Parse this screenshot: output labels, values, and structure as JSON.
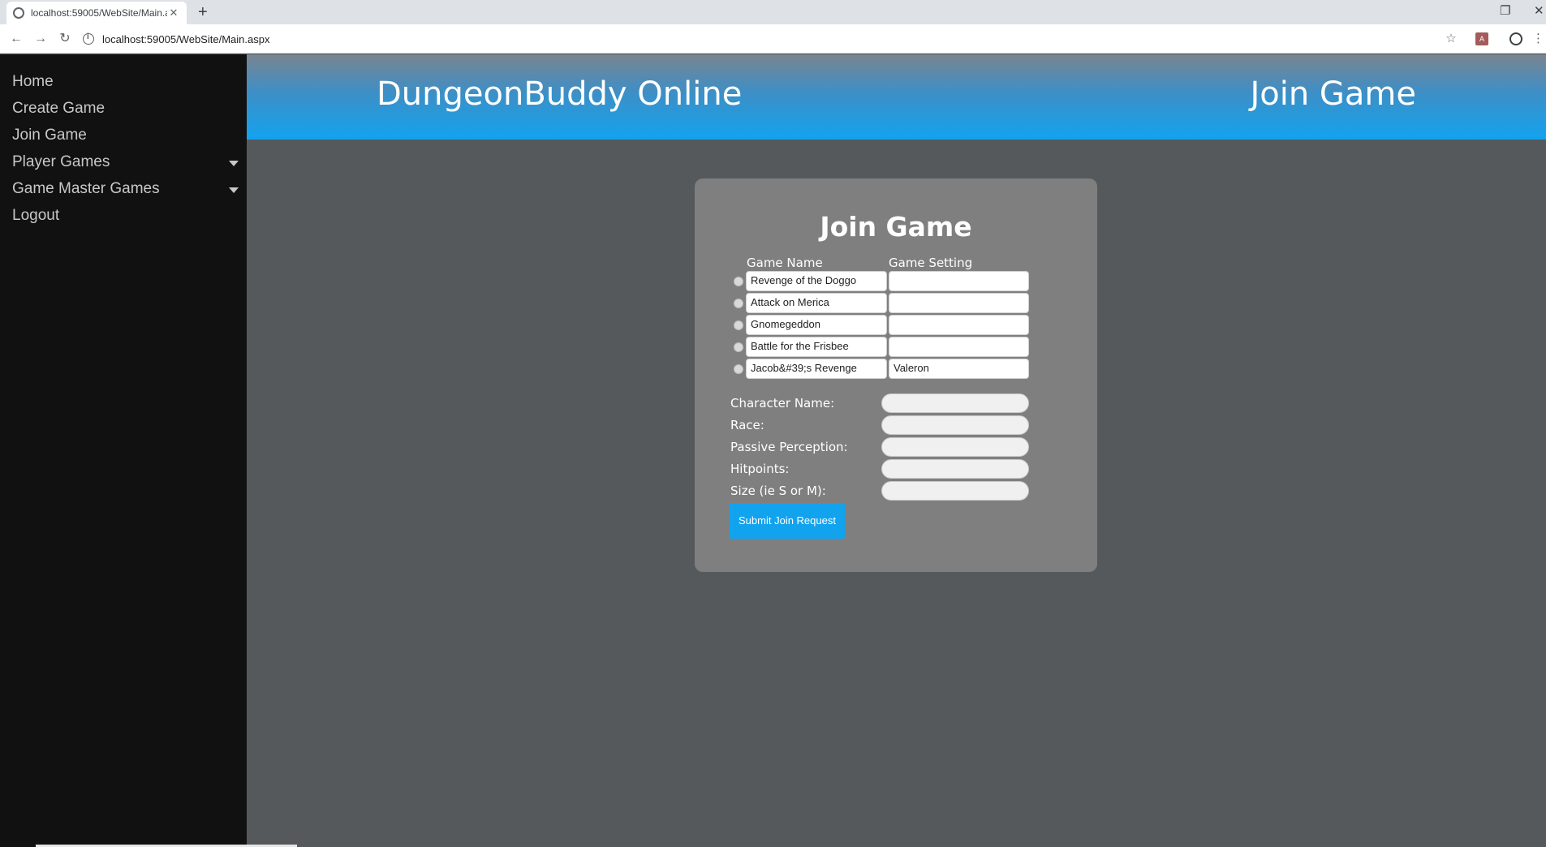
{
  "browser": {
    "tab_title": "localhost:59005/WebSite/Main.a",
    "new_tab": "+",
    "url": "localhost:59005/WebSite/Main.aspx"
  },
  "sidebar": {
    "items": [
      {
        "label": "Home"
      },
      {
        "label": "Create Game"
      },
      {
        "label": "Join Game"
      },
      {
        "label": "Player Games",
        "dropdown": true
      },
      {
        "label": "Game Master Games",
        "dropdown": true
      },
      {
        "label": "Logout"
      }
    ]
  },
  "header": {
    "site_title": "DungeonBuddy Online",
    "page_title": "Join Game"
  },
  "panel": {
    "title": "Join Game",
    "columns": {
      "name": "Game Name",
      "setting": "Game Setting"
    },
    "games": [
      {
        "name": "Revenge of the Doggo",
        "setting": ""
      },
      {
        "name": "Attack on Merica",
        "setting": ""
      },
      {
        "name": "Gnomegeddon",
        "setting": ""
      },
      {
        "name": "Battle for the Frisbee",
        "setting": ""
      },
      {
        "name": "Jacob&#39;s Revenge",
        "setting": "Valeron"
      }
    ],
    "fields": [
      {
        "label": "Character Name:",
        "value": ""
      },
      {
        "label": "Race:",
        "value": ""
      },
      {
        "label": "Passive Perception:",
        "value": ""
      },
      {
        "label": "Hitpoints:",
        "value": ""
      },
      {
        "label": "Size (ie S or M):",
        "value": ""
      }
    ],
    "submit_label": "Submit Join Request"
  },
  "colors": {
    "accent": "#12a3ef",
    "sidebar_bg": "#111111",
    "page_bg": "#55595c",
    "panel_bg": "#7f7f7f"
  }
}
